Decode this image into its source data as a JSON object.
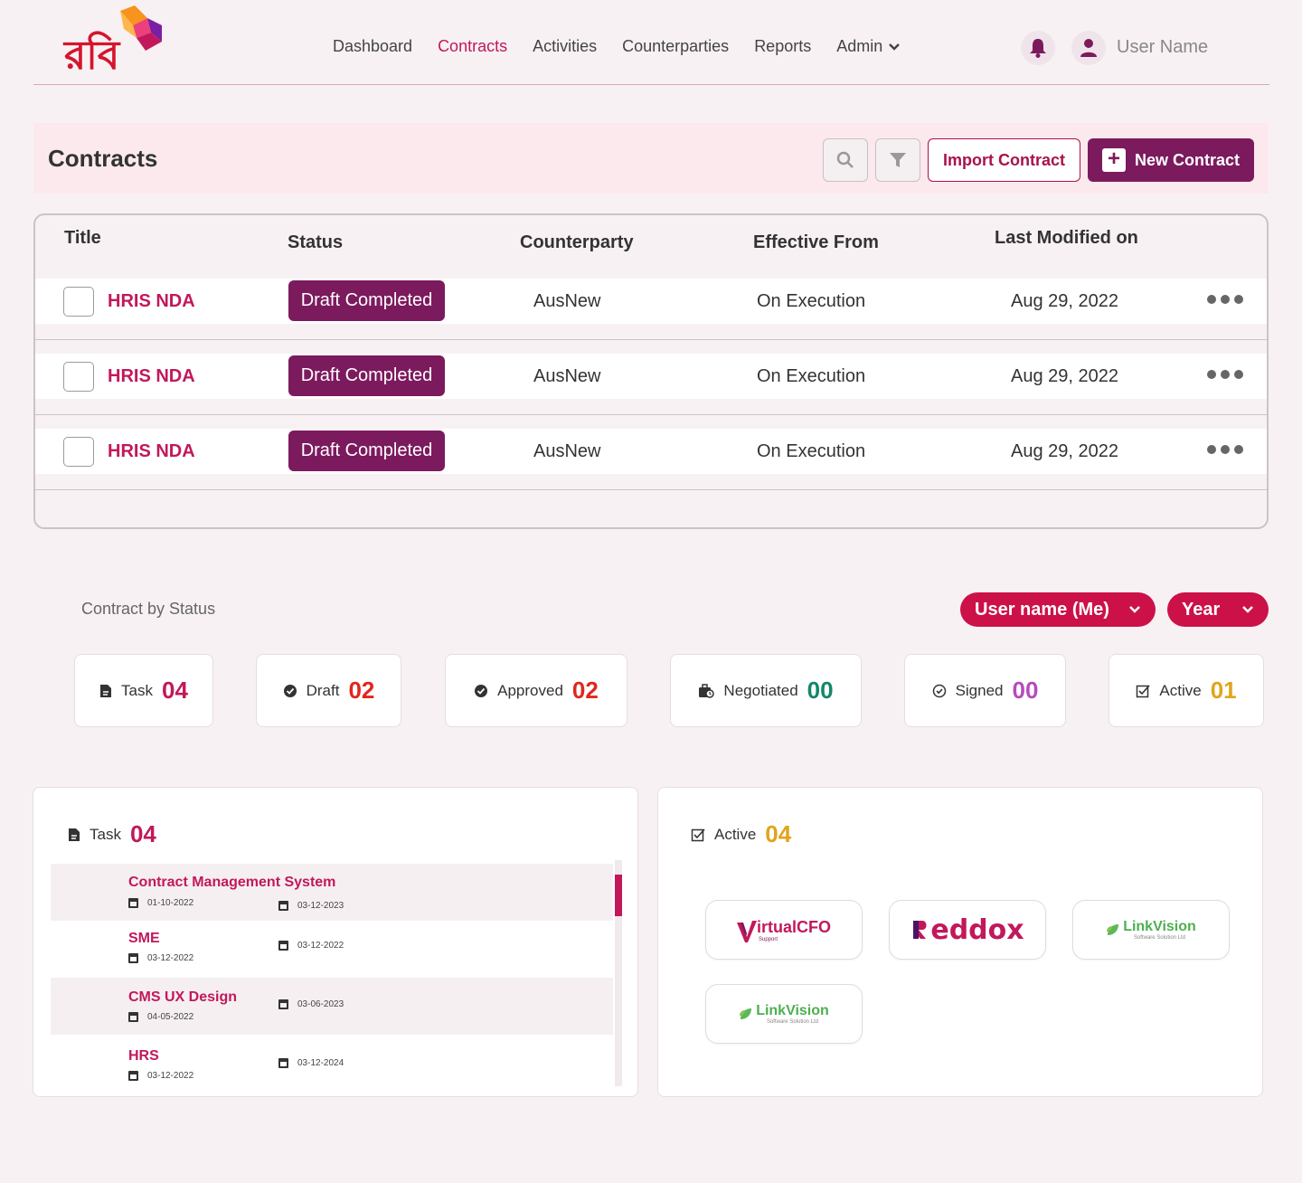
{
  "brand": {
    "logo_text": "রবি",
    "primary": "#c2185b",
    "purple": "#7c1a5e"
  },
  "nav": {
    "items": [
      {
        "label": "Dashboard",
        "active": false
      },
      {
        "label": "Contracts",
        "active": true
      },
      {
        "label": "Activities",
        "active": false
      },
      {
        "label": "Counterparties",
        "active": false
      },
      {
        "label": "Reports",
        "active": false
      },
      {
        "label": "Admin",
        "active": false
      }
    ],
    "user_name": "User Name"
  },
  "contracts": {
    "title": "Contracts",
    "import_label": "Import Contract",
    "new_label": "New Contract",
    "columns": [
      "Title",
      "Status",
      "Counterparty",
      "Effective From",
      "Last Modified on"
    ],
    "rows": [
      {
        "title": "HRIS NDA",
        "status": "Draft Completed",
        "counterparty": "AusNew",
        "effective": "On Execution",
        "modified": "Aug 29, 2022"
      },
      {
        "title": "HRIS NDA",
        "status": "Draft Completed",
        "counterparty": "AusNew",
        "effective": "On Execution",
        "modified": "Aug 29, 2022"
      },
      {
        "title": "HRIS NDA",
        "status": "Draft Completed",
        "counterparty": "AusNew",
        "effective": "On Execution",
        "modified": "Aug 29, 2022"
      }
    ]
  },
  "status_section": {
    "label": "Contract by Status",
    "filter_user": "User name (Me)",
    "filter_year": "Year",
    "cards": [
      {
        "label": "Task",
        "count": "04",
        "color": "#c2185b",
        "icon": "file-icon"
      },
      {
        "label": "Draft",
        "count": "02",
        "color": "#e0261f",
        "icon": "badge-check-icon"
      },
      {
        "label": "Approved",
        "count": "02",
        "color": "#e0261f",
        "icon": "badge-check-icon"
      },
      {
        "label": "Negotiated",
        "count": "00",
        "color": "#13876a",
        "icon": "briefcase-clock-icon"
      },
      {
        "label": "Signed",
        "count": "00",
        "color": "#b54bbd",
        "icon": "circle-check-icon"
      },
      {
        "label": "Active",
        "count": "01",
        "color": "#e0a51b",
        "icon": "square-check-icon"
      }
    ]
  },
  "task_panel": {
    "label": "Task",
    "count": "04",
    "items": [
      {
        "name": "Contract Management System",
        "start": "01-10-2022",
        "end": "03-12-2023"
      },
      {
        "name": "SME",
        "start": "03-12-2022",
        "end": "03-12-2022"
      },
      {
        "name": "CMS UX Design",
        "start": "04-05-2022",
        "end": "03-06-2023"
      },
      {
        "name": "HRS",
        "start": "03-12-2022",
        "end": "03-12-2024"
      }
    ]
  },
  "active_panel": {
    "label": "Active",
    "count": "04",
    "partners": [
      {
        "name": "irtualCFO",
        "sub": "Support"
      },
      {
        "name": "eddox"
      },
      {
        "name": "LinkVision",
        "sub": "Software Solution Ltd"
      },
      {
        "name": "LinkVision",
        "sub": "Software Solution Ltd"
      }
    ]
  }
}
